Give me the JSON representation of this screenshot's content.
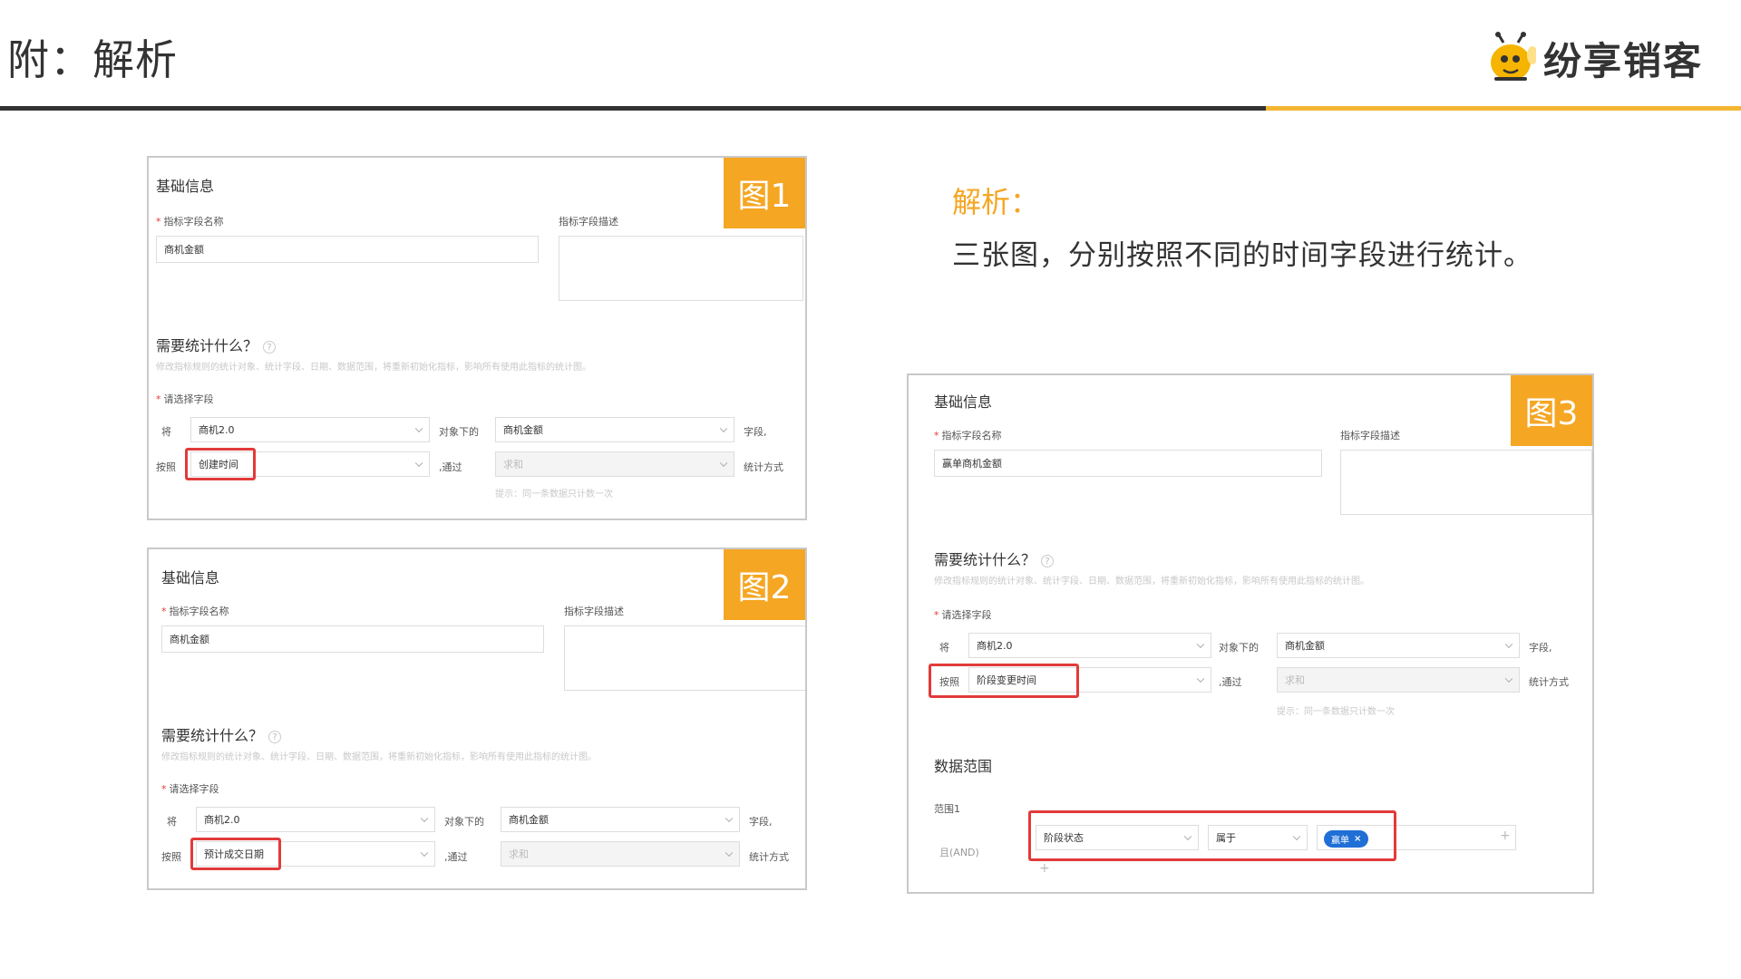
{
  "header": {
    "title": "附：解析",
    "brand": "纷享销客"
  },
  "colors": {
    "accent": "#f5a623",
    "rule_dark": "#333333",
    "rule_gold": "#f2b632",
    "highlight": "#e23a3a",
    "chip": "#1f6fd6"
  },
  "analysis": {
    "title": "解析：",
    "body": "三张图，分别按照不同的时间字段进行统计。"
  },
  "fig1": {
    "tag": "图1",
    "section": "基础信息",
    "name_label": "指标字段名称",
    "desc_label": "指标字段描述",
    "name_value": "商机金额",
    "question": "需要统计什么？",
    "qmark": "?",
    "hint": "修改指标规则的统计对象、统计字段、日期、数据范围，将重新初始化指标，影响所有使用此指标的统计图。",
    "field_label": "请选择字段",
    "row1_prefix": "将",
    "object": "商机2.0",
    "row1_mid": "对象下的",
    "field": "商机金额",
    "row1_suffix": "字段,",
    "row2_prefix": "按照",
    "date_field": "创建时间",
    "row2_mid": ",通过",
    "agg": "求和",
    "row2_suffix": "统计方式",
    "tip": "提示：同一条数据只计数一次"
  },
  "fig2": {
    "tag": "图2",
    "section": "基础信息",
    "name_label": "指标字段名称",
    "desc_label": "指标字段描述",
    "name_value": "商机金额",
    "question": "需要统计什么？",
    "qmark": "?",
    "hint": "修改指标规则的统计对象、统计字段、日期、数据范围，将重新初始化指标，影响所有使用此指标的统计图。",
    "field_label": "请选择字段",
    "row1_prefix": "将",
    "object": "商机2.0",
    "row1_mid": "对象下的",
    "field": "商机金额",
    "row1_suffix": "字段,",
    "row2_prefix": "按照",
    "date_field": "预计成交日期",
    "row2_mid": ",通过",
    "agg": "求和",
    "row2_suffix": "统计方式"
  },
  "fig3": {
    "tag": "图3",
    "section": "基础信息",
    "name_label": "指标字段名称",
    "desc_label": "指标字段描述",
    "name_value": "赢单商机金额",
    "question": "需要统计什么？",
    "qmark": "?",
    "hint": "修改指标规则的统计对象、统计字段、日期、数据范围，将重新初始化指标，影响所有使用此指标的统计图。",
    "field_label": "请选择字段",
    "row1_prefix": "将",
    "object": "商机2.0",
    "row1_mid": "对象下的",
    "field": "商机金额",
    "row1_suffix": "字段,",
    "row2_prefix": "按照",
    "date_field": "阶段变更时间",
    "row2_mid": ",通过",
    "agg": "求和",
    "row2_suffix": "统计方式",
    "tip": "提示：同一条数据只计数一次",
    "range_title": "数据范围",
    "range_label": "范围1",
    "and_label": "且(AND)",
    "cond_field": "阶段状态",
    "cond_op": "属于",
    "cond_value": "赢单",
    "chip_close": "×",
    "plus": "+"
  }
}
